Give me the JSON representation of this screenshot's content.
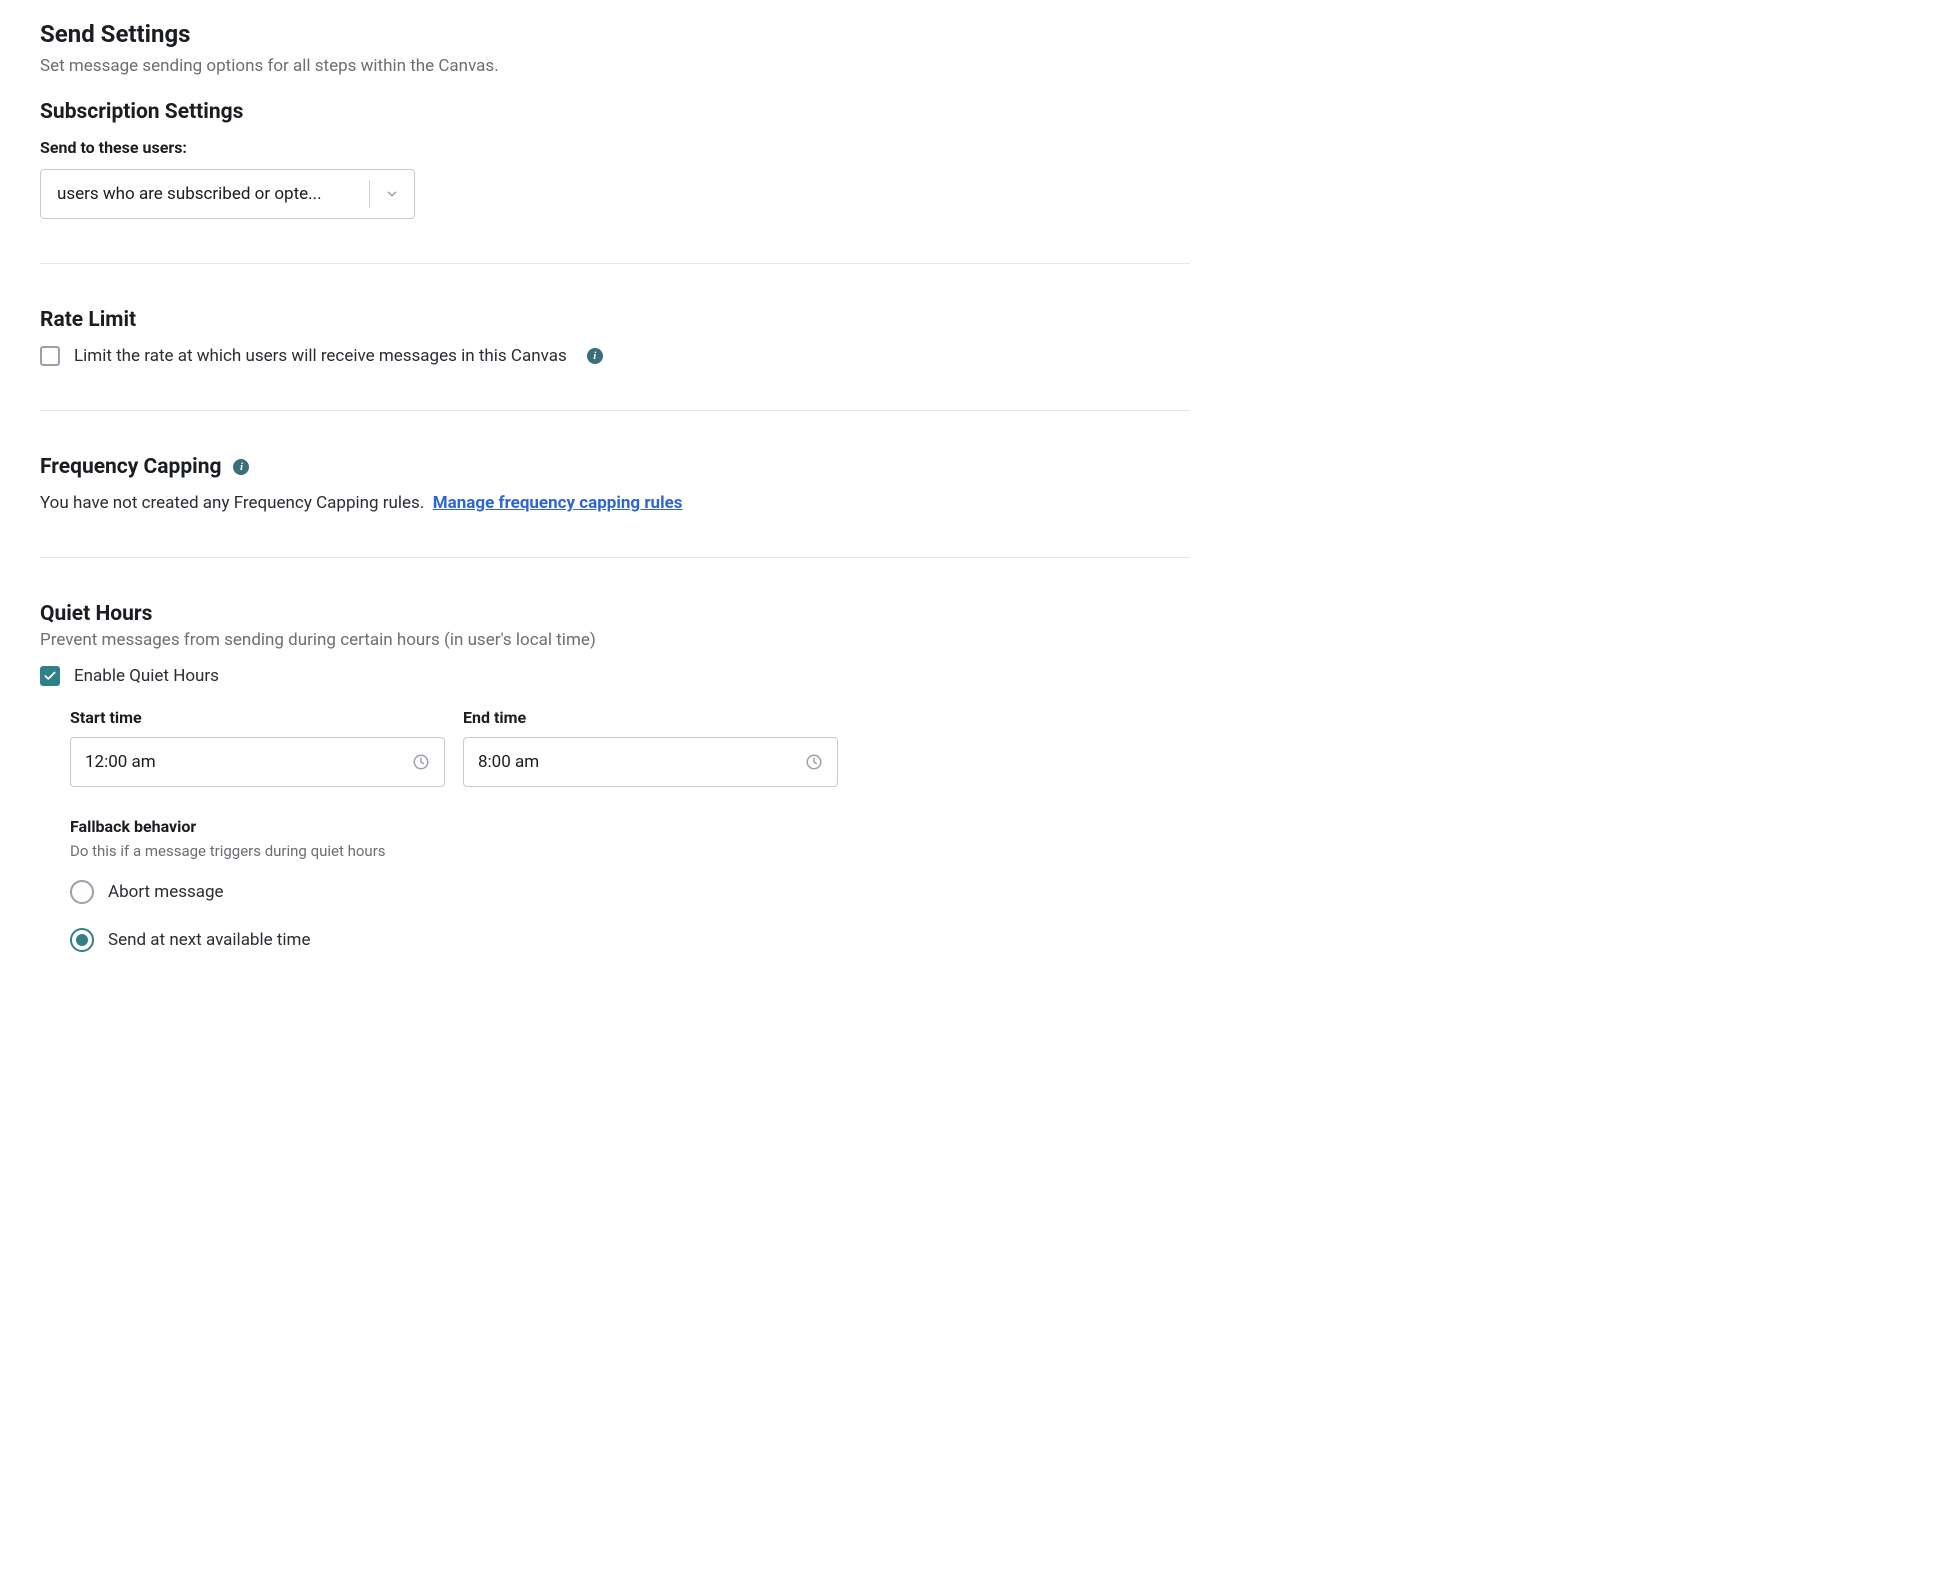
{
  "page": {
    "title": "Send Settings",
    "subtitle": "Set message sending options for all steps within the Canvas."
  },
  "subscription": {
    "title": "Subscription Settings",
    "label": "Send to these users:",
    "selected": "users who are subscribed or opte..."
  },
  "rate_limit": {
    "title": "Rate Limit",
    "checkbox_label": "Limit the rate at which users will receive messages in this Canvas",
    "checked": false
  },
  "frequency_capping": {
    "title": "Frequency Capping",
    "body": "You have not created any Frequency Capping rules.",
    "link_text": "Manage frequency capping rules"
  },
  "quiet_hours": {
    "title": "Quiet Hours",
    "subtitle": "Prevent messages from sending during certain hours (in user's local time)",
    "enable_label": "Enable Quiet Hours",
    "enabled": true,
    "start_label": "Start time",
    "start_value": "12:00 am",
    "end_label": "End time",
    "end_value": "8:00 am",
    "fallback_title": "Fallback behavior",
    "fallback_sub": "Do this if a message triggers during quiet hours",
    "options": {
      "abort": "Abort message",
      "send_next": "Send at next available time"
    },
    "selected_option": "send_next"
  }
}
